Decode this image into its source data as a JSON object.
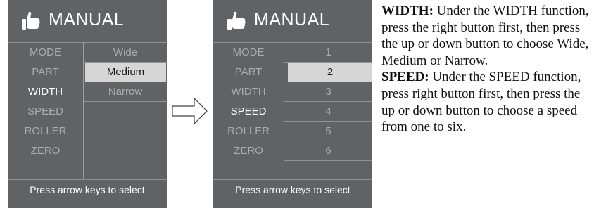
{
  "panel_left": {
    "title": "MANUAL",
    "menu_items": [
      "MODE",
      "PART",
      "WIDTH",
      "SPEED",
      "ROLLER",
      "ZERO"
    ],
    "active_item": "WIDTH",
    "options": [
      "Wide",
      "Medium",
      "Narrow"
    ],
    "selected_option": "Medium",
    "footer": "Press arrow keys to select"
  },
  "panel_right": {
    "title": "MANUAL",
    "menu_items": [
      "MODE",
      "PART",
      "WIDTH",
      "SPEED",
      "ROLLER",
      "ZERO"
    ],
    "active_item": "SPEED",
    "options": [
      "1",
      "2",
      "3",
      "4",
      "5",
      "6"
    ],
    "selected_option": "2",
    "footer": "Press arrow keys to select"
  },
  "icons": {
    "header_icon": "thumbs-up-icon",
    "transition_icon": "arrow-right-icon"
  },
  "instructions": {
    "width_heading": "WIDTH:",
    "width_text": " Under the WIDTH function, press the right button first, then press the up or down button to choose Wide, Medium or Narrow.",
    "speed_heading": "SPEED:",
    "speed_text": " Under the SPEED function, press right button first, then press the up or down button to choose a speed from one to six."
  },
  "colors": {
    "panel_bg": "#5f6366",
    "selected_bg": "#d6d6d6",
    "inactive_text": "#a9adb0",
    "active_text": "#ffffff"
  }
}
